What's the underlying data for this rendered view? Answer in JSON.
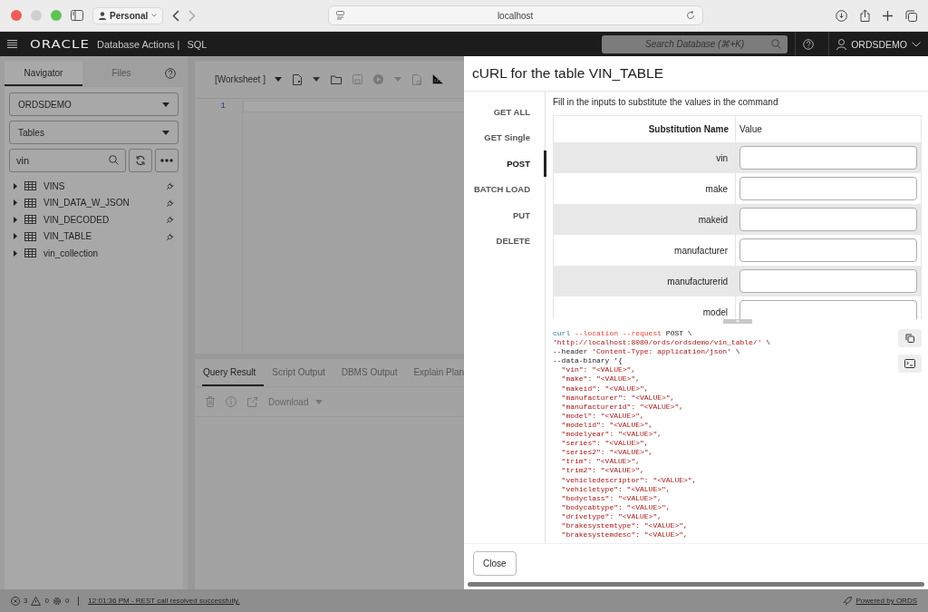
{
  "browser": {
    "profile": "Personal",
    "url": "localhost"
  },
  "header": {
    "logo": "ORACLE",
    "product": "Database Actions |",
    "app": "SQL",
    "search_placeholder": "Search Database (⌘+K)",
    "user": "ORDSDEMO"
  },
  "navigator": {
    "tabs": [
      {
        "label": "Navigator",
        "selected": true
      },
      {
        "label": "Files",
        "selected": false
      }
    ],
    "schema": "ORDSDEMO",
    "object_type": "Tables",
    "filter": "vin",
    "items": [
      {
        "name": "VINS",
        "rest_enabled": true
      },
      {
        "name": "VIN_DATA_W_JSON",
        "rest_enabled": true
      },
      {
        "name": "VIN_DECODED",
        "rest_enabled": true
      },
      {
        "name": "VIN_TABLE",
        "rest_enabled": true
      },
      {
        "name": "vin_collection",
        "rest_enabled": false
      }
    ]
  },
  "worksheet": {
    "name": "[Worksheet ]",
    "line_numbers": [
      "1"
    ],
    "result_tabs": [
      {
        "label": "Query Result",
        "selected": true
      },
      {
        "label": "Script Output",
        "selected": false
      },
      {
        "label": "DBMS Output",
        "selected": false
      },
      {
        "label": "Explain Plan",
        "selected": false
      }
    ],
    "download": "Download"
  },
  "dialog": {
    "title": "cURL for the table VIN_TABLE",
    "methods": [
      {
        "label": "GET ALL",
        "selected": false
      },
      {
        "label": "GET Single",
        "selected": false
      },
      {
        "label": "POST",
        "selected": true
      },
      {
        "label": "BATCH LOAD",
        "selected": false
      },
      {
        "label": "PUT",
        "selected": false
      },
      {
        "label": "DELETE",
        "selected": false
      }
    ],
    "hint": "Fill in the inputs to substitute the values in the command",
    "columns": [
      "Substitution Name",
      "Value"
    ],
    "rows": [
      {
        "name": "vin"
      },
      {
        "name": "make"
      },
      {
        "name": "makeid"
      },
      {
        "name": "manufacturer"
      },
      {
        "name": "manufacturerid"
      },
      {
        "name": "model"
      }
    ],
    "code": [
      [
        {
          "text": "curl",
          "kind": "command"
        },
        {
          "text": " --location --request",
          "kind": "option"
        },
        {
          "text": " POST \\",
          "kind": "plain"
        }
      ],
      [
        {
          "text": "'http://localhost:8080/ords/ordsdemo/vin_table/'",
          "kind": "string"
        },
        {
          "text": " \\",
          "kind": "plain"
        }
      ],
      [
        {
          "text": "--header",
          "kind": "plain"
        },
        {
          "text": " 'Content-Type: application/json'",
          "kind": "string"
        },
        {
          "text": " \\",
          "kind": "plain"
        }
      ],
      [
        {
          "text": "--data-binary '{",
          "kind": "plain"
        }
      ],
      [
        {
          "text": "  \"vin\": \"<VALUE>\",",
          "kind": "string"
        }
      ],
      [
        {
          "text": "  \"make\": \"<VALUE>\",",
          "kind": "string"
        }
      ],
      [
        {
          "text": "  \"makeid\": \"<VALUE>\",",
          "kind": "string"
        }
      ],
      [
        {
          "text": "  \"manufacturer\": \"<VALUE>\",",
          "kind": "string"
        }
      ],
      [
        {
          "text": "  \"manufacturerid\": \"<VALUE>\",",
          "kind": "string"
        }
      ],
      [
        {
          "text": "  \"model\": \"<VALUE>\",",
          "kind": "string"
        }
      ],
      [
        {
          "text": "  \"modelid\": \"<VALUE>\",",
          "kind": "string"
        }
      ],
      [
        {
          "text": "  \"modelyear\": \"<VALUE>\",",
          "kind": "string"
        }
      ],
      [
        {
          "text": "  \"series\": \"<VALUE>\",",
          "kind": "string"
        }
      ],
      [
        {
          "text": "  \"series2\": \"<VALUE>\",",
          "kind": "string"
        }
      ],
      [
        {
          "text": "  \"trim\": \"<VALUE>\",",
          "kind": "string"
        }
      ],
      [
        {
          "text": "  \"trim2\": \"<VALUE>\",",
          "kind": "string"
        }
      ],
      [
        {
          "text": "  \"vehicledescriptor\": \"<VALUE>\",",
          "kind": "string"
        }
      ],
      [
        {
          "text": "  \"vehicletype\": \"<VALUE>\",",
          "kind": "string"
        }
      ],
      [
        {
          "text": "  \"bodyclass\": \"<VALUE>\",",
          "kind": "string"
        }
      ],
      [
        {
          "text": "  \"bodycabtype\": \"<VALUE>\",",
          "kind": "string"
        }
      ],
      [
        {
          "text": "  \"drivetype\": \"<VALUE>\",",
          "kind": "string"
        }
      ],
      [
        {
          "text": "  \"brakesystemtype\": \"<VALUE>\",",
          "kind": "string"
        }
      ],
      [
        {
          "text": "  \"brakesystemdesc\": \"<VALUE>\",",
          "kind": "string"
        }
      ]
    ],
    "close": "Close"
  },
  "status": {
    "errors": "3",
    "warnings": "0",
    "tasks": "0",
    "message": "12:01:36 PM - REST call resolved successfully.",
    "powered": "Powered by ORDS"
  }
}
